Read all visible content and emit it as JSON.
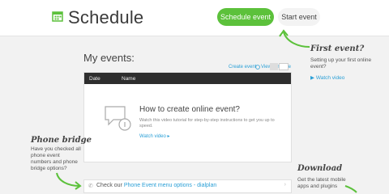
{
  "header": {
    "title": "Schedule",
    "primary_button": "Schedule event",
    "secondary_button": "Start event"
  },
  "first_event": {
    "heading": "First event?",
    "text": "Setting up your first online event?",
    "link": "Watch video"
  },
  "events": {
    "heading": "My events:",
    "create_link": "Create event",
    "timeline_link": "View time line",
    "columns": [
      "Date",
      "Name"
    ],
    "empty_title": "How to create online event?",
    "empty_desc": "Watch this video tutorial for step-by-step instructions to get you up to speed.",
    "empty_link": "Watch video ▸"
  },
  "phone_bridge": {
    "heading": "Phone bridge",
    "text": "Have you checked all phone event numbers and phone bridge options?"
  },
  "download": {
    "heading": "Download",
    "text": "Get the latest mobile apps and plugins"
  },
  "bottom_bar": {
    "prefix": "Check our ",
    "link": "Phone Event menu options - dialplan",
    "chevron": "›"
  },
  "colors": {
    "accent_green": "#5cc13b",
    "link_blue": "#2a9fd6",
    "table_header": "#2e2e2e"
  }
}
